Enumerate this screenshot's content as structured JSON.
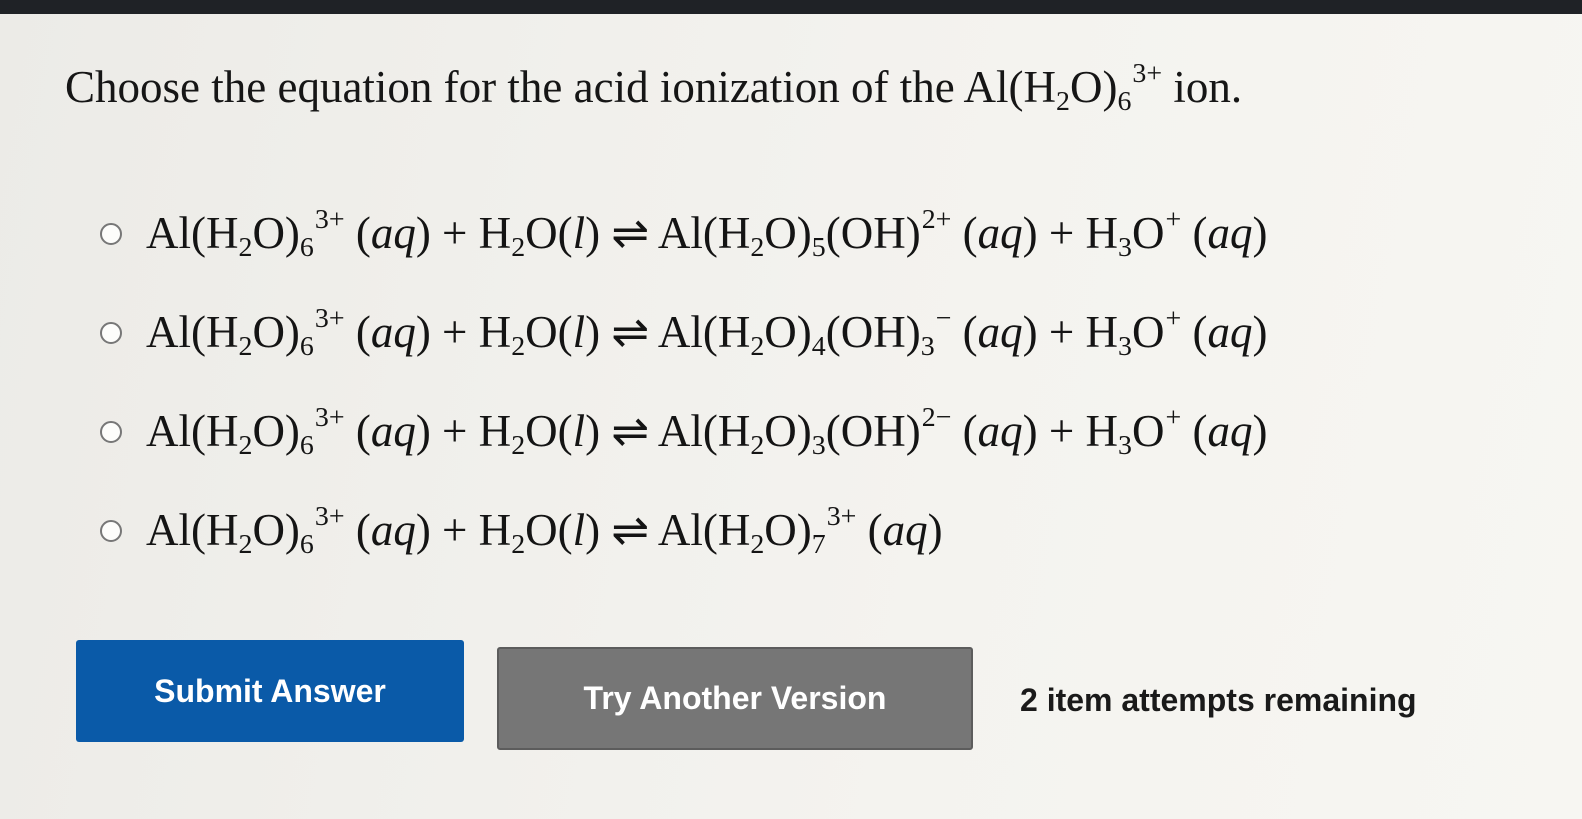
{
  "question": {
    "prefix": "Choose the equation for the acid ionization of the",
    "suffix": "ion."
  },
  "options": [
    {
      "label": "Al(H2O)6 3+ (aq) + H2O(l) ⇌ Al(H2O)5(OH)2+ (aq) + H3O+ (aq)"
    },
    {
      "label": "Al(H2O)6 3+ (aq) + H2O(l) ⇌ Al(H2O)4(OH)3 − (aq) + H3O+ (aq)"
    },
    {
      "label": "Al(H2O)6 3+ (aq) + H2O(l) ⇌ Al(H2O)3(OH) 2− (aq) + H3O+ (aq)"
    },
    {
      "label": "Al(H2O)6 3+ (aq) + H2O(l) ⇌ Al(H2O)7 3+ (aq)"
    }
  ],
  "buttons": {
    "submit": "Submit Answer",
    "try_another": "Try Another Version"
  },
  "attempts_text": "2 item attempts remaining",
  "colors": {
    "submit_bg": "#0a5aa8",
    "try_bg": "#767676"
  }
}
